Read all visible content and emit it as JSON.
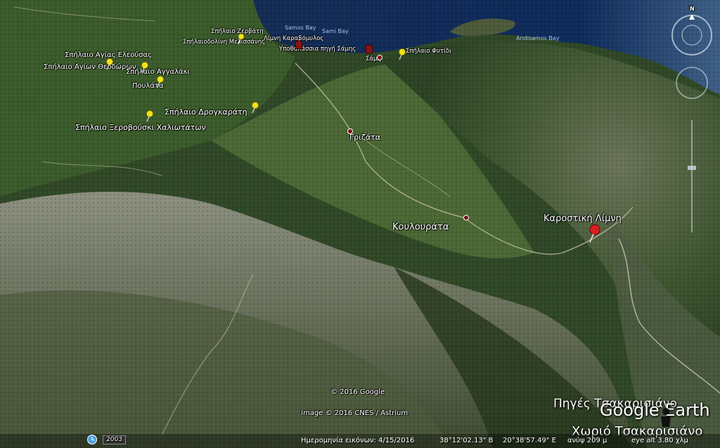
{
  "water_labels": {
    "samos_bay_1": "Samos Bay",
    "samos_bay_2": "Sami Bay",
    "andisamos_bay": "Andisamos Bay"
  },
  "places": {
    "spilaio_zervati": "Σπήλαιο Ζερβάτη",
    "melissani": "Σπήλαιοδολίνη Μελισσάνης",
    "karavomylos": "Λίμνη Καραβόμυλος",
    "ypothalassia": "Υποθαλάσσια πηγή Σάμης",
    "fytidi": "Σπήλαιο Φυτίδι",
    "sami": "Σάμη",
    "agias_eleousas": "Σπήλαιο Αγίας Ελεούσας",
    "agion_theodoron": "Σπήλαιο Αγίων Θεοδώρων",
    "angalaki": "Σπήλαιο Αγγαλάκι",
    "poulata": "Πουλάτα",
    "drogarati": "Σπήλαιο Δρογκαράτη",
    "xerovouski": "Σπήλαιο Ξεροβούσκι Χαλιωτάτων",
    "grizata": "Γριζάτα",
    "koulourata": "Κουλουράτα",
    "karostiki": "Καροστική Λίμνη",
    "piges": "Πηγές Τσακαρισιάνο",
    "chorio": "Χωριό Τσακαρισιάνο"
  },
  "overlay": {
    "copyright": "© 2016 Google",
    "image_credit": "Image © 2016 CNES / Astrium",
    "logo": "Google Earth",
    "north": "N",
    "historical_year": "2003"
  },
  "status": {
    "image_date": "Ημερομηνία εικόνων: 4/15/2016",
    "lat": "38°12'02.13\" Β",
    "lon": "20°38'57.49\" Ε",
    "elev": "ανύψ  209 μ",
    "eye_alt": "eye alt  3.80 χλμ"
  },
  "colors": {
    "sea": "#0d2a5c",
    "land_dark": "#2c4422",
    "land_green": "#3d5e2c",
    "rock": "#7d8270",
    "pin_yellow": "#f2e21a",
    "pin_red": "#d62020"
  }
}
